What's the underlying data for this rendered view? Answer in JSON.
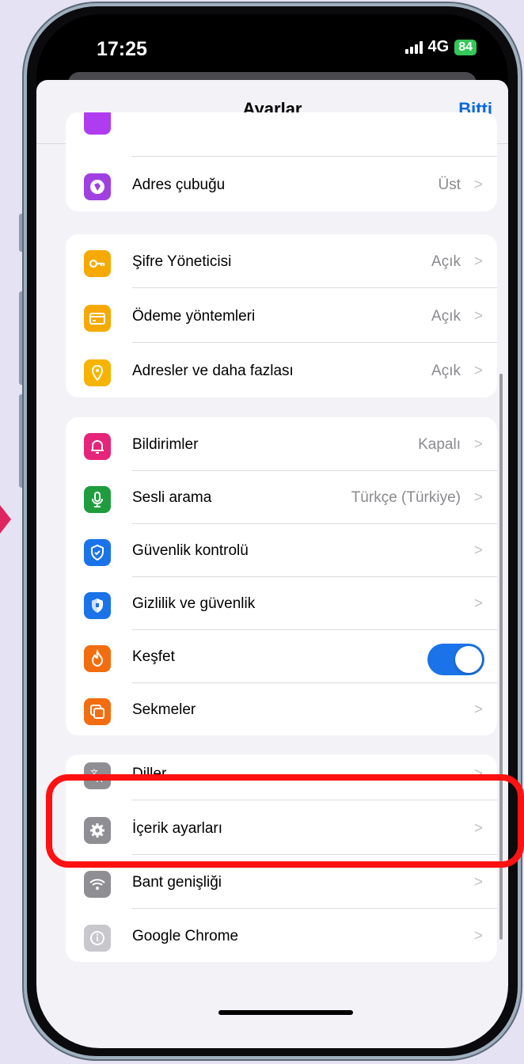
{
  "status": {
    "time": "17:25",
    "network": "4G",
    "battery": "84"
  },
  "nav": {
    "title": "Ayarlar",
    "done": "Bitti"
  },
  "groups": [
    {
      "items": [
        {
          "label": "Adres çubuğu",
          "value": "Üst",
          "icon": "globe-icon",
          "color": "#a040e0"
        }
      ]
    },
    {
      "items": [
        {
          "label": "Şifre Yöneticisi",
          "value": "Açık",
          "icon": "key-icon",
          "color": "#f6a900"
        },
        {
          "label": "Ödeme yöntemleri",
          "value": "Açık",
          "icon": "card-icon",
          "color": "#f6a900"
        },
        {
          "label": "Adresler ve daha fazlası",
          "value": "Açık",
          "icon": "pin-icon",
          "color": "#f6b400"
        }
      ]
    },
    {
      "items": [
        {
          "label": "Bildirimler",
          "value": "Kapalı",
          "icon": "bell-icon",
          "color": "#e6247a"
        },
        {
          "label": "Sesli arama",
          "value": "Türkçe (Türkiye)",
          "icon": "mic-icon",
          "color": "#1f9d3e"
        },
        {
          "label": "Güvenlik kontrolü",
          "value": "",
          "icon": "shield-check-icon",
          "color": "#1a73e8"
        },
        {
          "label": "Gizlilik ve güvenlik",
          "value": "",
          "icon": "shield-icon",
          "color": "#1a73e8"
        },
        {
          "label": "Keşfet",
          "toggle": true,
          "icon": "flame-icon",
          "color": "#f26d0f"
        },
        {
          "label": "Sekmeler",
          "value": "",
          "icon": "tabs-icon",
          "color": "#f26d0f"
        }
      ]
    },
    {
      "items": [
        {
          "label": "Diller",
          "value": "",
          "icon": "translate-icon",
          "color": "#8e8e93"
        },
        {
          "label": "İçerik ayarları",
          "value": "",
          "icon": "gear-icon",
          "color": "#8e8e93"
        },
        {
          "label": "Bant genişliği",
          "value": "",
          "icon": "wifi-icon",
          "color": "#8e8e93"
        },
        {
          "label": "Google Chrome",
          "value": "",
          "icon": "info-icon",
          "color": "#8e8e93"
        }
      ]
    }
  ],
  "chevron": ">",
  "colors": {
    "accent": "#1a73e8",
    "highlight": "#ff1111"
  }
}
